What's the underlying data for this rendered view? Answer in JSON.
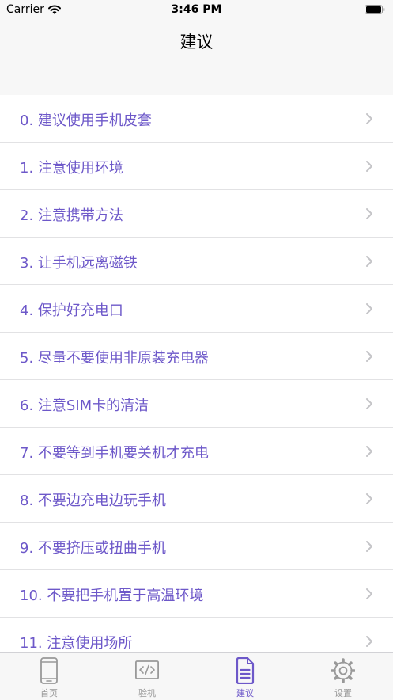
{
  "status_bar": {
    "carrier": "Carrier",
    "time": "3:46 PM"
  },
  "nav": {
    "title": "建议"
  },
  "list": {
    "items": [
      {
        "label": "0. 建议使用手机皮套"
      },
      {
        "label": "1. 注意使用环境"
      },
      {
        "label": "2. 注意携带方法"
      },
      {
        "label": "3. 让手机远离磁铁"
      },
      {
        "label": "4. 保护好充电口"
      },
      {
        "label": "5. 尽量不要使用非原装充电器"
      },
      {
        "label": "6. 注意SIM卡的清洁"
      },
      {
        "label": "7. 不要等到手机要关机才充电"
      },
      {
        "label": "8. 不要边充电边玩手机"
      },
      {
        "label": "9. 不要挤压或扭曲手机"
      },
      {
        "label": "10. 不要把手机置于高温环境"
      },
      {
        "label": "11. 注意使用场所"
      }
    ]
  },
  "tab_bar": {
    "tabs": [
      {
        "label": "首页",
        "icon": "phone-icon"
      },
      {
        "label": "验机",
        "icon": "code-icon"
      },
      {
        "label": "建议",
        "icon": "document-icon",
        "active": true
      },
      {
        "label": "设置",
        "icon": "gear-icon"
      }
    ]
  },
  "colors": {
    "accent": "#6d58c9",
    "inactive": "#999999",
    "bar_background": "#f7f7f7"
  }
}
